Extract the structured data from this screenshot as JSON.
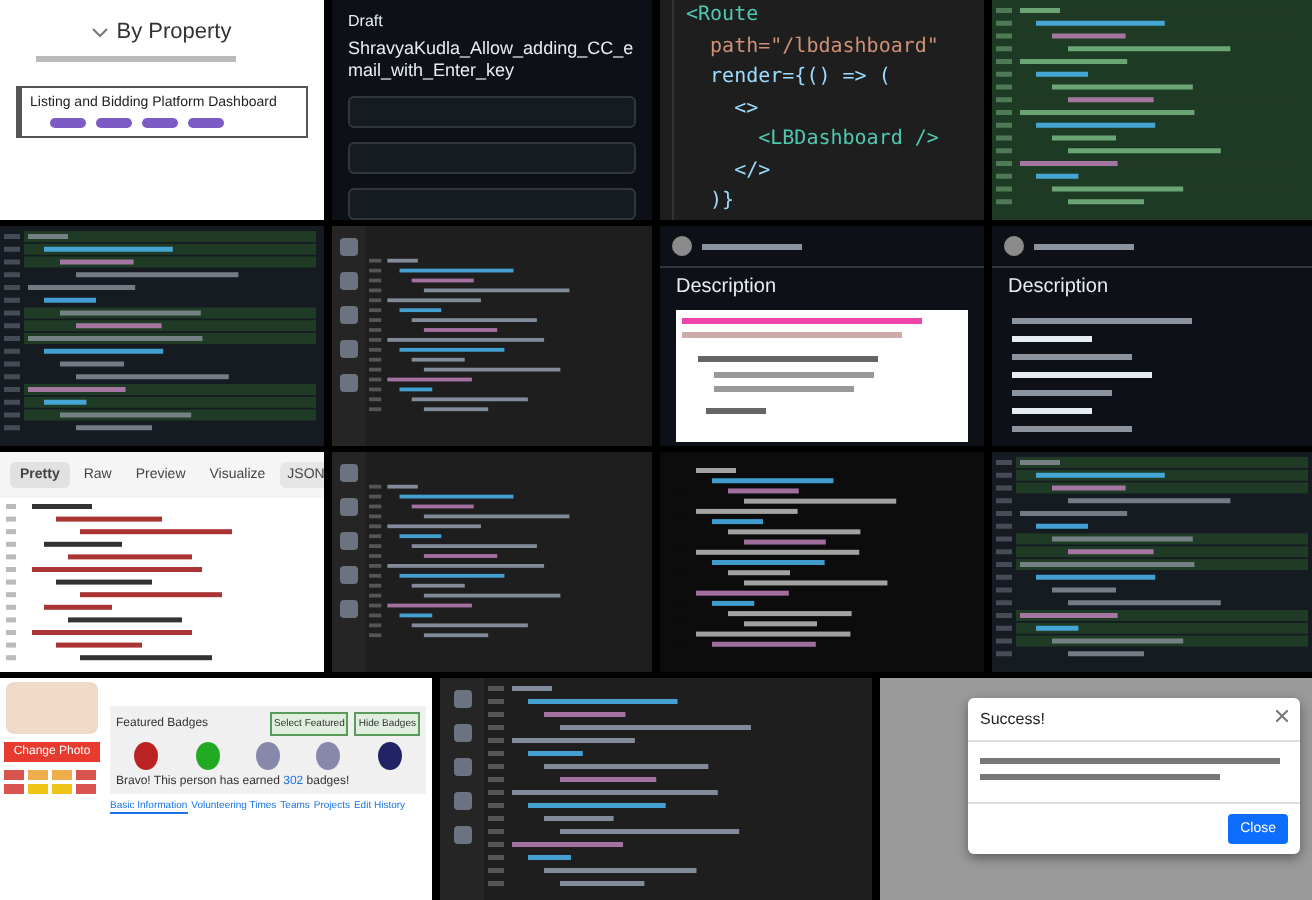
{
  "rows": [
    {
      "tiles": [
        {
          "kind": "doc",
          "heading": "By Property",
          "panel_title": "Listing and Bidding Platform Dashboard"
        },
        {
          "kind": "pr",
          "status": "Draft",
          "title": "ShravyaKudla_Allow_adding_CC_email_with_Enter_key"
        },
        {
          "kind": "code_zoom",
          "lines": [
            "<Route",
            "  path=\"/lbdashboard\"",
            "  render={() => (",
            "    <>",
            "      <LBDashboard />",
            "    </>",
            "  )}"
          ]
        },
        {
          "kind": "editor_green"
        }
      ]
    },
    {
      "tiles": [
        {
          "kind": "editor_diff"
        },
        {
          "kind": "editor_dark"
        },
        {
          "kind": "description_doc",
          "heading": "Description"
        },
        {
          "kind": "description",
          "heading": "Description"
        }
      ]
    },
    {
      "tiles": [
        {
          "kind": "api_json",
          "tabs": [
            {
              "label": "Pretty",
              "selected": true
            },
            {
              "label": "Raw",
              "selected": false
            },
            {
              "label": "Preview",
              "selected": false
            },
            {
              "label": "Visualize",
              "selected": false
            }
          ],
          "format": "JSON"
        },
        {
          "kind": "editor_dark"
        },
        {
          "kind": "terminal"
        },
        {
          "kind": "editor_diff"
        }
      ]
    },
    {
      "tiles": [
        {
          "kind": "profile",
          "photo_button": "Change Photo",
          "featured_title": "Featured Badges",
          "buttons": [
            "Select Featured",
            "Hide Badges"
          ],
          "earned_prefix": "Bravo! This person has earned",
          "earned_count": "302",
          "earned_suffix": "badges!",
          "tabs": [
            {
              "label": "Basic Information",
              "selected": true
            },
            {
              "label": "Volunteering Times",
              "selected": false
            },
            {
              "label": "Teams",
              "selected": false
            },
            {
              "label": "Projects",
              "selected": false
            },
            {
              "label": "Edit History",
              "selected": false
            }
          ]
        },
        {
          "kind": "editor_dark"
        },
        {
          "kind": "modal",
          "title": "Success!",
          "button": "Close"
        }
      ]
    }
  ]
}
